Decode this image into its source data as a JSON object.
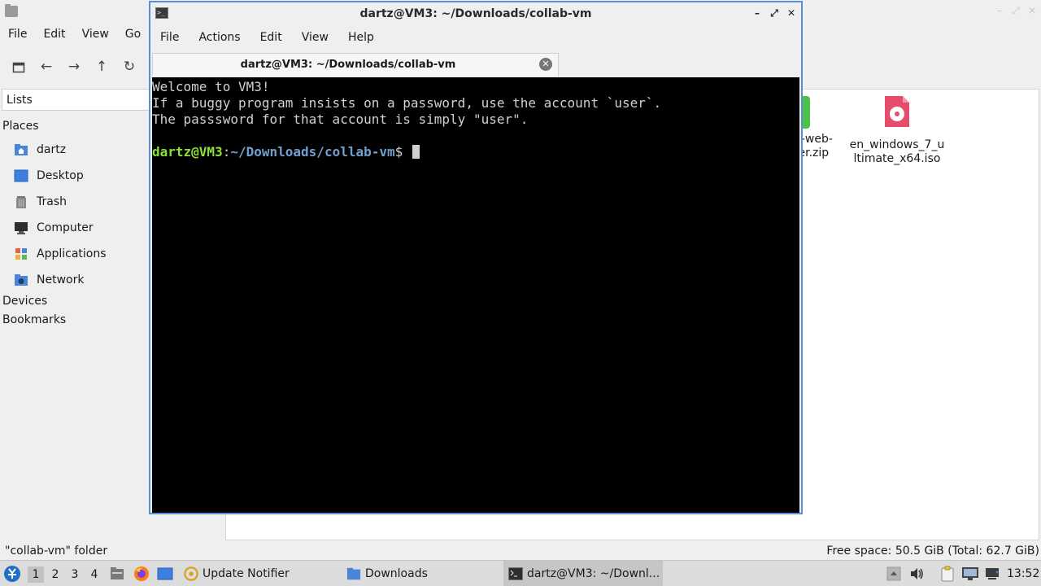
{
  "file_manager": {
    "menu": [
      "File",
      "Edit",
      "View",
      "Go"
    ],
    "side_combo": "Lists",
    "places_heading": "Places",
    "places": [
      {
        "label": "dartz",
        "icon": "home-folder-icon"
      },
      {
        "label": "Desktop",
        "icon": "desktop-icon"
      },
      {
        "label": "Trash",
        "icon": "trash-icon"
      },
      {
        "label": "Computer",
        "icon": "computer-icon"
      },
      {
        "label": "Applications",
        "icon": "applications-icon"
      },
      {
        "label": "Network",
        "icon": "network-icon"
      }
    ],
    "devices_heading": "Devices",
    "bookmarks_heading": "Bookmarks",
    "files": [
      {
        "name_line1": "n-web-",
        "name_line2": "ter.zip",
        "icon": "zip-archive-icon"
      },
      {
        "name_line1": "en_windows_7_u",
        "name_line2": "ltimate_x64.iso",
        "icon": "disc-image-icon"
      }
    ],
    "status_left": "\"collab-vm\" folder",
    "status_right": "Free space: 50.5 GiB (Total: 62.7 GiB)"
  },
  "terminal": {
    "title": "dartz@VM3: ~/Downloads/collab-vm",
    "menu": [
      "File",
      "Actions",
      "Edit",
      "View",
      "Help"
    ],
    "tab_title": "dartz@VM3: ~/Downloads/collab-vm",
    "lines": [
      "Welcome to VM3!",
      "If a buggy program insists on a password, use the account `user`.",
      "The passsword for that account is simply \"user\".",
      ""
    ],
    "prompt_user": "dartz@VM3",
    "prompt_sep": ":",
    "prompt_path": "~/Downloads/collab-vm",
    "prompt_symbol": "$ "
  },
  "taskbar": {
    "workspaces": [
      "1",
      "2",
      "3",
      "4"
    ],
    "active_workspace": "1",
    "tasks": [
      {
        "label": "Update Notifier",
        "icon": "update-notifier-icon"
      },
      {
        "label": "Downloads",
        "icon": "folder-icon"
      },
      {
        "label": "dartz@VM3: ~/Downl...",
        "icon": "terminal-icon"
      }
    ],
    "clock": "13:52"
  }
}
